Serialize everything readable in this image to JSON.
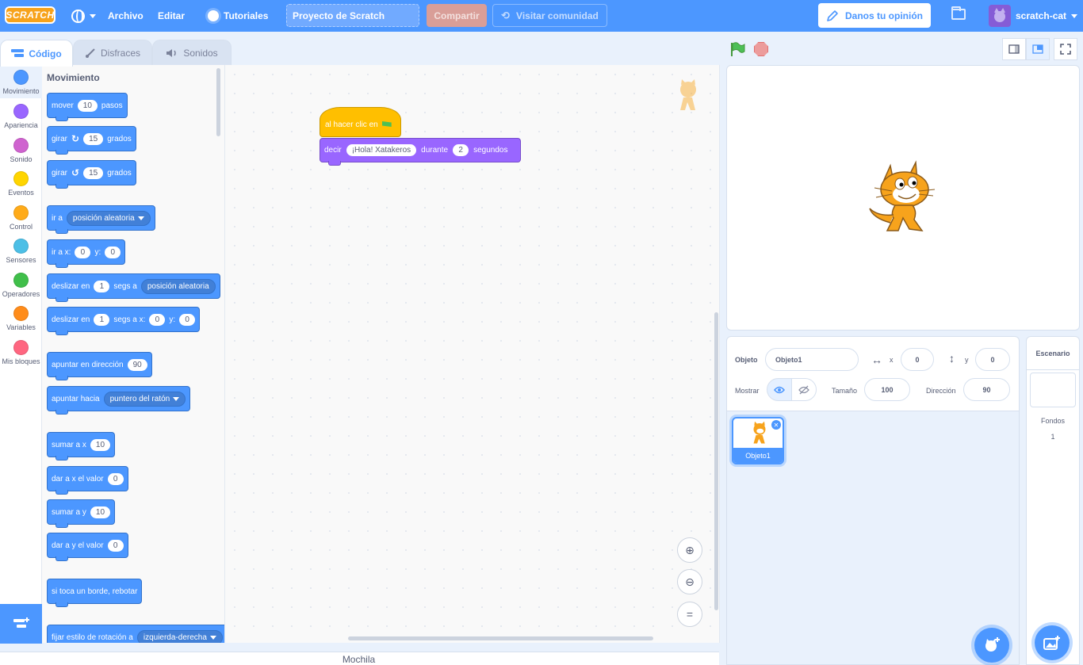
{
  "menu": {
    "logo": "SCRATCH",
    "archivo": "Archivo",
    "editar": "Editar",
    "tutoriales": "Tutoriales",
    "project_title": "Proyecto de Scratch",
    "share": "Compartir",
    "community": "Visitar comunidad",
    "feedback": "Danos tu opinión",
    "username": "scratch-cat"
  },
  "tabs": {
    "code": "Código",
    "costumes": "Disfraces",
    "sounds": "Sonidos"
  },
  "categories": [
    {
      "label": "Movimiento",
      "color": "#4c97ff"
    },
    {
      "label": "Apariencia",
      "color": "#9966ff"
    },
    {
      "label": "Sonido",
      "color": "#cf63cf"
    },
    {
      "label": "Eventos",
      "color": "#ffd500"
    },
    {
      "label": "Control",
      "color": "#ffab19"
    },
    {
      "label": "Sensores",
      "color": "#4cbfe6"
    },
    {
      "label": "Operadores",
      "color": "#40bf4a"
    },
    {
      "label": "Variables",
      "color": "#ff8c1a"
    },
    {
      "label": "Mis bloques",
      "color": "#ff6680"
    }
  ],
  "palette": {
    "title": "Movimiento",
    "mover": "mover",
    "mover_val": "10",
    "pasos": "pasos",
    "girar": "girar",
    "girar_val": "15",
    "grados": "grados",
    "ir_a": "ir a",
    "posicion_aleatoria": "posición aleatoria",
    "ir_a_x": "ir a x:",
    "y": "y:",
    "zero": "0",
    "deslizar_en": "deslizar en",
    "one": "1",
    "segs_a": "segs a",
    "segs_a_x": "segs a x:",
    "apuntar_dir": "apuntar en dirección",
    "ninety": "90",
    "apuntar_hacia": "apuntar hacia",
    "puntero": "puntero del ratón",
    "sumar_x": "sumar a x",
    "ten": "10",
    "dar_x": "dar a x el valor",
    "sumar_y": "sumar a y",
    "dar_y": "dar a y el valor",
    "rebotar": "si toca un borde, rebotar",
    "estilo": "fijar estilo de rotación a",
    "izq_der": "izquierda-derecha"
  },
  "script": {
    "hat": "al hacer clic en",
    "decir": "decir",
    "message": "¡Hola! Xatakeros",
    "durante": "durante",
    "secs": "2",
    "segundos": "segundos"
  },
  "backpack": "Mochila",
  "sprite_info": {
    "objeto_label": "Objeto",
    "objeto_name": "Objeto1",
    "x_label": "x",
    "x_val": "0",
    "y_label": "y",
    "y_val": "0",
    "mostrar": "Mostrar",
    "tamano_label": "Tamaño",
    "tamano_val": "100",
    "direccion_label": "Dirección",
    "direccion_val": "90"
  },
  "sprite_card": {
    "name": "Objeto1"
  },
  "stage_pane": {
    "title": "Escenario",
    "fondos_label": "Fondos",
    "fondos_count": "1"
  }
}
